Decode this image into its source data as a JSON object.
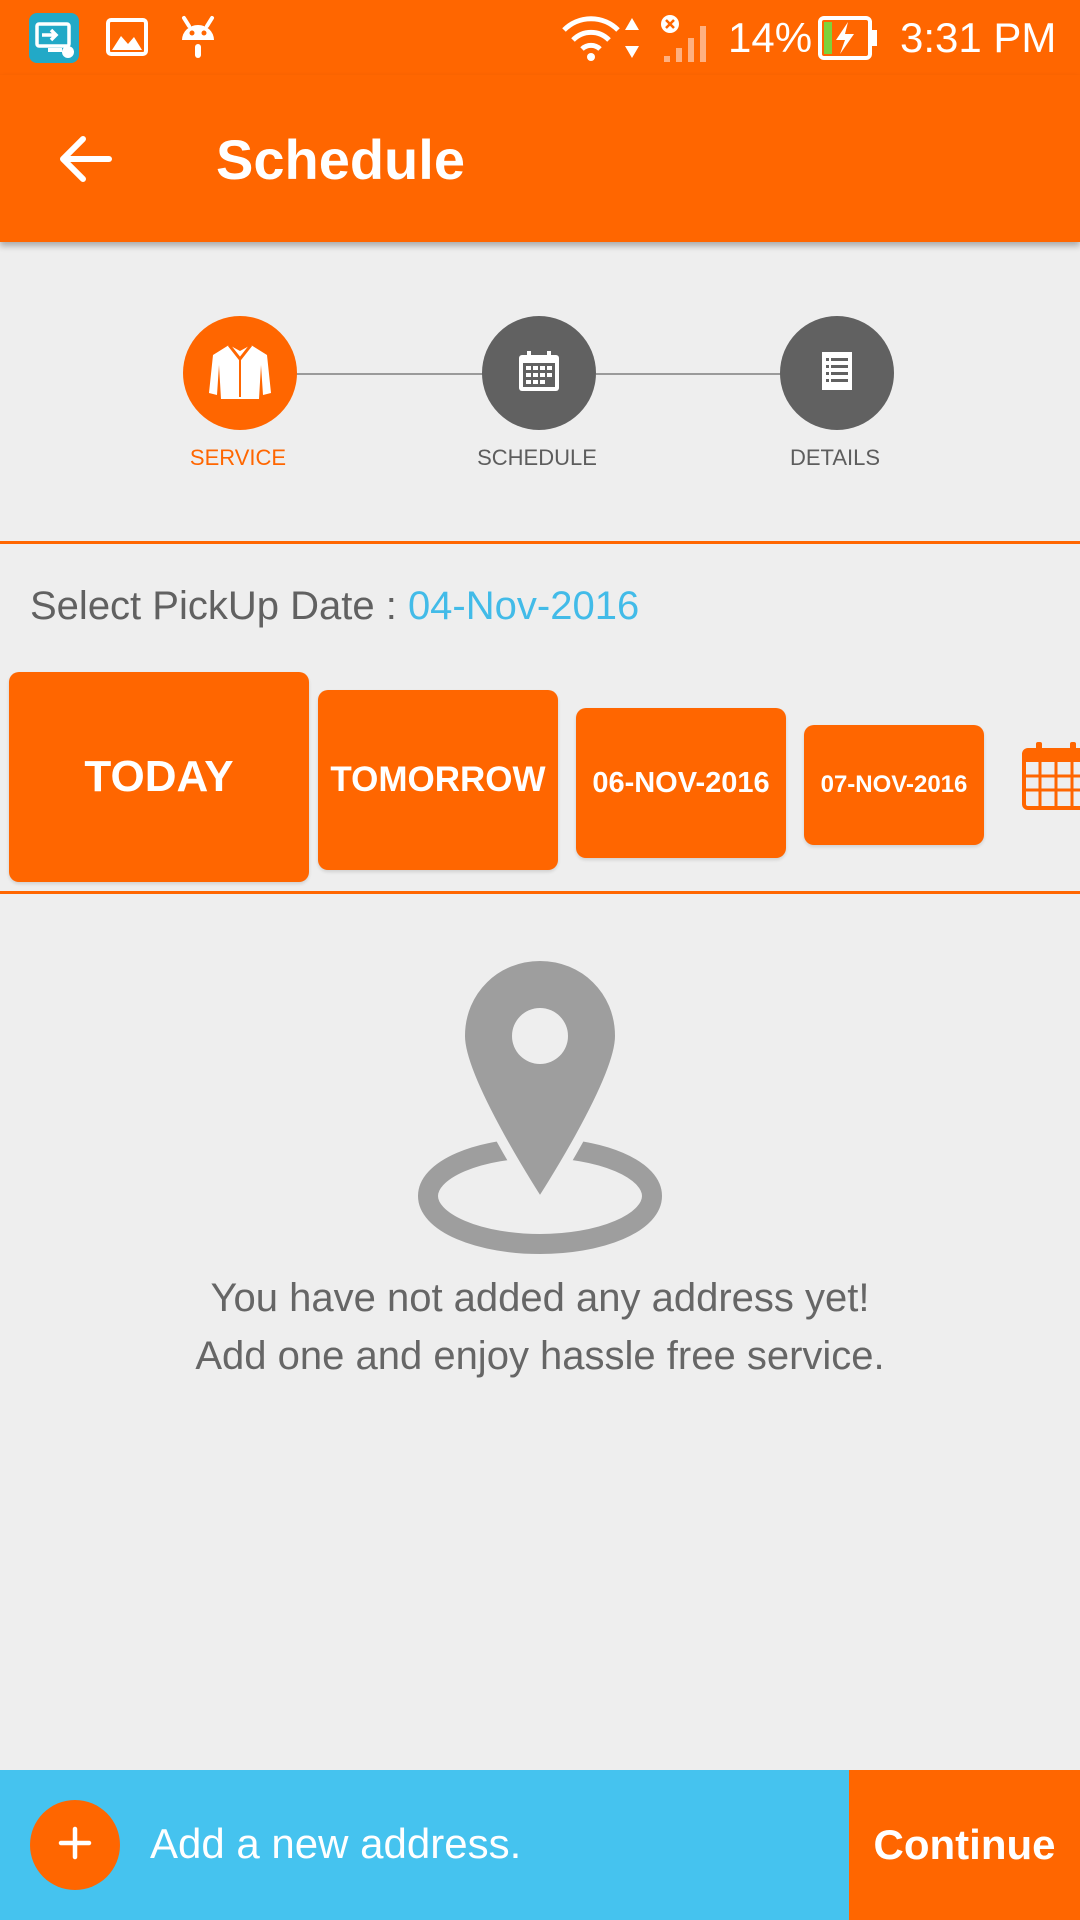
{
  "status_bar": {
    "battery": "14%",
    "time": "3:31 PM",
    "icons": [
      "screen-share-icon",
      "image-icon",
      "android-icon",
      "wifi-icon",
      "data-arrows-icon",
      "signal-icon",
      "battery-charging-icon"
    ]
  },
  "app_bar": {
    "title": "Schedule",
    "back_icon": "arrow-back-icon"
  },
  "stepper": {
    "steps": [
      {
        "label": "SERVICE",
        "icon": "shirt-icon",
        "state": "active"
      },
      {
        "label": "SCHEDULE",
        "icon": "calendar-icon",
        "state": "inactive"
      },
      {
        "label": "DETAILS",
        "icon": "document-icon",
        "state": "inactive"
      }
    ]
  },
  "pickup": {
    "label": "Select PickUp Date : ",
    "selected_date": "04-Nov-2016"
  },
  "date_options": [
    "TODAY",
    "TOMORROW",
    "06-NOV-2016",
    "07-NOV-2016"
  ],
  "empty_state": {
    "icon": "location-pin-icon",
    "line1": "You have not added any address yet!",
    "line2": "Add one and enjoy hassle free service."
  },
  "bottom_bar": {
    "add_address_label": "Add a new address.",
    "continue_label": "Continue"
  },
  "colors": {
    "primary": "#ff6600",
    "accent_blue": "#45c3ef",
    "background": "#eeeeee",
    "inactive_step": "#616161"
  }
}
